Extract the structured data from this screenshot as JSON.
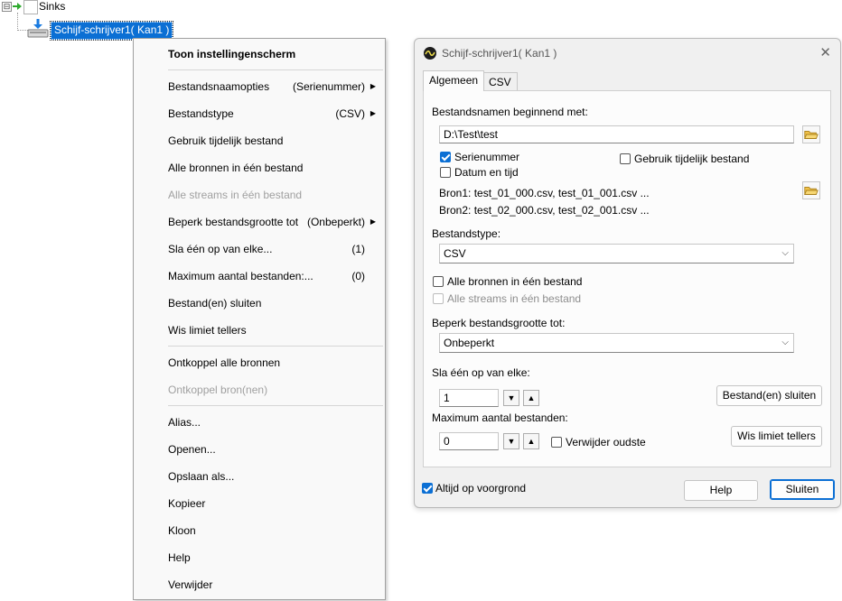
{
  "tree": {
    "root_label": "Sinks",
    "expander_symbol": "⊟",
    "selected_node": "Schijf-schrijver1( Kan1 )"
  },
  "context_menu": {
    "items": [
      {
        "label": "Toon instellingenscherm",
        "value": "",
        "submenu": false,
        "bold": true,
        "disabled": false
      },
      {
        "label": "Bestandsnaamopties",
        "value": "(Serienummer)",
        "submenu": true,
        "bold": false,
        "disabled": false
      },
      {
        "label": "Bestandstype",
        "value": "(CSV)",
        "submenu": true,
        "bold": false,
        "disabled": false
      },
      {
        "label": "Gebruik tijdelijk bestand",
        "value": "",
        "submenu": false,
        "bold": false,
        "disabled": false
      },
      {
        "label": "Alle bronnen in één bestand",
        "value": "",
        "submenu": false,
        "bold": false,
        "disabled": false
      },
      {
        "label": "Alle streams in één bestand",
        "value": "",
        "submenu": false,
        "bold": false,
        "disabled": true
      },
      {
        "label": "Beperk bestandsgrootte tot",
        "value": "(Onbeperkt)",
        "submenu": true,
        "bold": false,
        "disabled": false
      },
      {
        "label": "Sla één op van elke...",
        "value": "(1)",
        "submenu": false,
        "bold": false,
        "disabled": false
      },
      {
        "label": "Maximum aantal bestanden:...",
        "value": "(0)",
        "submenu": false,
        "bold": false,
        "disabled": false
      },
      {
        "label": "Bestand(en) sluiten",
        "value": "",
        "submenu": false,
        "bold": false,
        "disabled": false
      },
      {
        "label": "Wis limiet tellers",
        "value": "",
        "submenu": false,
        "bold": false,
        "disabled": false
      },
      {
        "label": "Ontkoppel alle bronnen",
        "value": "",
        "submenu": false,
        "bold": false,
        "disabled": false
      },
      {
        "label": "Ontkoppel bron(nen)",
        "value": "",
        "submenu": false,
        "bold": false,
        "disabled": true
      },
      {
        "label": "Alias...",
        "value": "",
        "submenu": false,
        "bold": false,
        "disabled": false
      },
      {
        "label": "Openen...",
        "value": "",
        "submenu": false,
        "bold": false,
        "disabled": false
      },
      {
        "label": "Opslaan als...",
        "value": "",
        "submenu": false,
        "bold": false,
        "disabled": false
      },
      {
        "label": "Kopieer",
        "value": "",
        "submenu": false,
        "bold": false,
        "disabled": false
      },
      {
        "label": "Kloon",
        "value": "",
        "submenu": false,
        "bold": false,
        "disabled": false
      },
      {
        "label": "Help",
        "value": "",
        "submenu": false,
        "bold": false,
        "disabled": false
      },
      {
        "label": "Verwijder",
        "value": "",
        "submenu": false,
        "bold": false,
        "disabled": false
      }
    ]
  },
  "dialog": {
    "title": "Schijf-schrijver1( Kan1 )",
    "close_symbol": "✕",
    "tabs": [
      {
        "label": "Algemeen",
        "active": true
      },
      {
        "label": "CSV",
        "active": false
      }
    ],
    "filename_prefix_label": "Bestandsnamen beginnend met:",
    "filename_prefix_value": "D:\\Test\\test",
    "serial_number_label": "Serienummer",
    "serial_number_checked": true,
    "date_time_label": "Datum en tijd",
    "date_time_checked": false,
    "temp_file_label": "Gebruik tijdelijk bestand",
    "temp_file_checked": false,
    "source1": "Bron1: test_01_000.csv, test_01_001.csv ...",
    "source2": "Bron2: test_02_000.csv, test_02_001.csv ...",
    "file_type_label": "Bestandstype:",
    "file_type_value": "CSV",
    "all_sources_label": "Alle bronnen in één bestand",
    "all_sources_checked": false,
    "all_streams_label": "Alle streams in één bestand",
    "all_streams_checked": false,
    "limit_size_label": "Beperk bestandsgrootte tot:",
    "limit_size_value": "Onbeperkt",
    "save_every_label": "Sla één op van elke:",
    "save_every_value": "1",
    "close_files_button": "Bestand(en) sluiten",
    "max_files_label": "Maximum aantal bestanden:",
    "max_files_value": "0",
    "delete_oldest_label": "Verwijder oudste",
    "delete_oldest_checked": false,
    "clear_counters_button": "Wis limiet tellers",
    "always_on_top_label": "Altijd op voorgrond",
    "always_on_top_checked": true,
    "help_button": "Help",
    "close_button": "Sluiten",
    "spin_down_symbol": "▼",
    "spin_up_symbol": "▲"
  }
}
